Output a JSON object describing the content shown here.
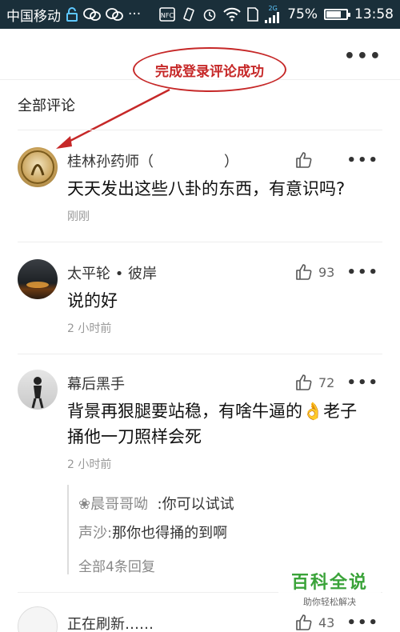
{
  "status_bar": {
    "carrier": "中国移动",
    "network_tag": "2G",
    "battery": "75%",
    "battery_level": 0.75,
    "time": "13:58"
  },
  "annotation": "完成登录评论成功",
  "section_title": "全部评论",
  "comments": [
    {
      "author": "桂林孙药师（",
      "author_suffix": "）",
      "text": "天天发出这些八卦的东西，有意识吗?",
      "time": "刚刚",
      "likes": ""
    },
    {
      "author": "太平轮 • 彼岸",
      "text": "说的好",
      "time": "2 小时前",
      "likes": "93"
    },
    {
      "author": "幕后黑手",
      "text": "背景再狠腿要站稳，有啥牛逼的👌老子捅他一刀照样会死",
      "time": "2 小时前",
      "likes": "72"
    },
    {
      "author": "正在刷新……",
      "likes": "43"
    }
  ],
  "replies": [
    {
      "who": "❀晨哥哥呦",
      "text": ":你可以试试"
    },
    {
      "who": "声沙:",
      "text": "那你也得捅的到啊"
    }
  ],
  "reply_all": "全部4条回复",
  "watermark": {
    "title": "百科全说",
    "subtitle": "助你轻松解决"
  },
  "icons": {
    "more": "more-dots-icon",
    "like": "thumbs-up-icon"
  }
}
